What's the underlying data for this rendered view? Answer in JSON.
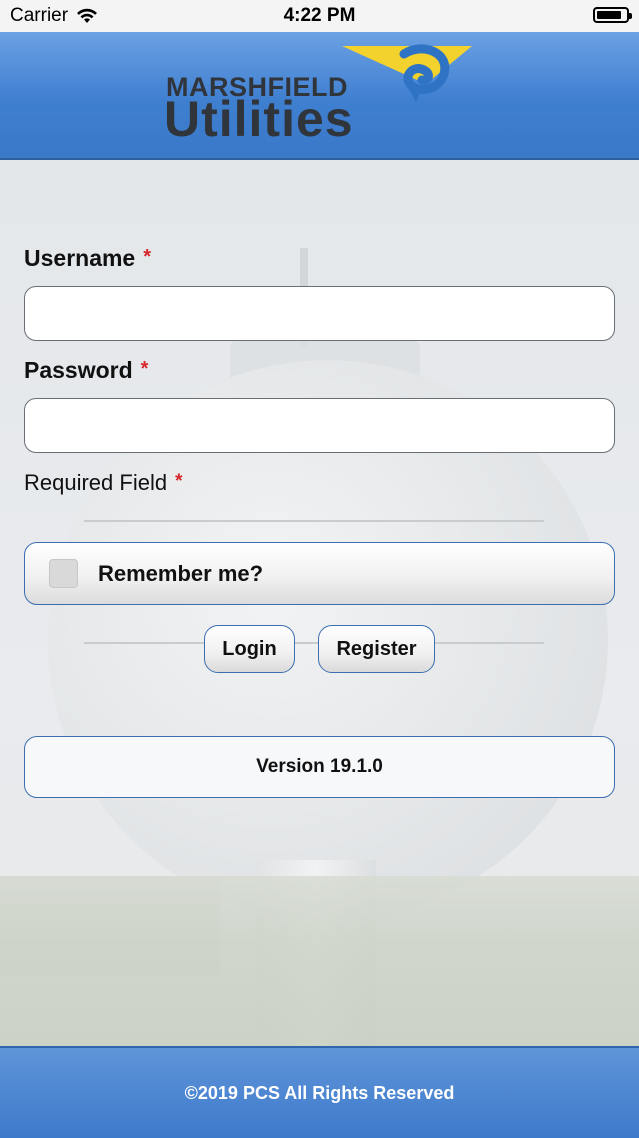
{
  "status_bar": {
    "carrier": "Carrier",
    "time": "4:22 PM"
  },
  "header": {
    "logo_top": "MARSHFIELD",
    "logo_bottom": "Utilities",
    "colors": {
      "header_blue": "#3f7fd0",
      "logo_yellow": "#f3d22e",
      "logo_blue": "#2f73c4"
    }
  },
  "form": {
    "username_label": "Username",
    "username_required": "*",
    "username_value": "",
    "password_label": "Password",
    "password_required": "*",
    "password_value": "",
    "required_note": "Required Field",
    "required_note_star": "*",
    "remember_label": "Remember me?",
    "remember_checked": false,
    "login_label": "Login",
    "register_label": "Register"
  },
  "version_label": "Version 19.1.0",
  "footer": {
    "copyright": "©2019 PCS All Rights Reserved"
  },
  "background": {
    "tower_text": "MARSHFIELD"
  }
}
